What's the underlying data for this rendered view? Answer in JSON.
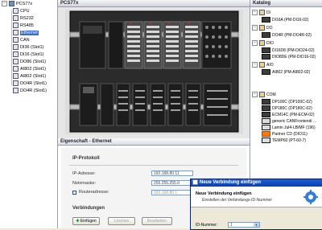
{
  "tree": {
    "root_label": "PCS77x",
    "items": [
      {
        "label": "CPU",
        "icon": "cpu-icon"
      },
      {
        "label": "RS232",
        "icon": "port-icon"
      },
      {
        "label": "RS485",
        "icon": "port-icon"
      },
      {
        "label": "Ethernet",
        "icon": "network-icon",
        "selected": true
      },
      {
        "label": "CAN",
        "icon": "bus-icon"
      },
      {
        "label": "DI36 (Slot1)",
        "icon": "module-icon"
      },
      {
        "label": "DI16 (Slot1)",
        "icon": "module-icon"
      },
      {
        "label": "DO86 (Slot1)",
        "icon": "module-icon"
      },
      {
        "label": "AI802 (Slot1)",
        "icon": "module-icon"
      },
      {
        "label": "AI802 (Slot1)",
        "icon": "module-icon"
      },
      {
        "label": "DO4R (Slot1)",
        "icon": "module-icon"
      },
      {
        "label": "DO4R (Slot1)",
        "icon": "module-icon"
      }
    ]
  },
  "device_view": {
    "title": "PCS77x"
  },
  "properties": {
    "title": "Eigenschaft - Ethernet",
    "section_ip": "IP-Protokoll",
    "ip_label": "IP-Adresse:",
    "ip_value": "192.168.80.11",
    "mask_label": "Netzmaske:",
    "mask_value": "255.255.255.0",
    "gateway_label": "Routeradresse:",
    "gateway_value": "192.168.80.1",
    "section_conn": "Verbindungen",
    "add_button": "Einfügen",
    "delete_button": "Löschen",
    "edit_button": "Bearbeiten"
  },
  "catalog": {
    "title": "Katalog",
    "groups": [
      {
        "label": "DI",
        "items": [
          "DI16A (PM-DI16-02)"
        ]
      },
      {
        "label": "DO",
        "items": [
          "DO4R (PM-DO4R-02)"
        ]
      },
      {
        "label": "DIO",
        "items": [
          "DI16D8 (PM-DIO24-02)",
          "DIO8DE (PM-DIO16-02)"
        ]
      },
      {
        "label": "AIO",
        "items": [
          "AI802 (PM-AI802-02)"
        ]
      },
      {
        "label": "COM",
        "items": [
          "DP100C (DP100C-02)",
          "DP180C (DP180C-02)",
          "ECM14C (PM-ECM-02)",
          "generic CANFrontendi ...",
          "Lamin Jul4-LB/MF (196)",
          "Partner CD (DIO11)",
          "TEMP60 (PT-60-7)"
        ]
      }
    ]
  },
  "dialog": {
    "title": "Neue Verbindung einfügen",
    "heading": "Neue Verbindung einfügen",
    "subheading": "Einstellen der Verbindungs-ID-Nummer",
    "id_label": "ID-Nummer:",
    "id_value": "1"
  },
  "colors": {
    "selection": "#3a6cc6",
    "dialog_title": "#0b3fae",
    "catalog_highlight": "#ff7800"
  }
}
